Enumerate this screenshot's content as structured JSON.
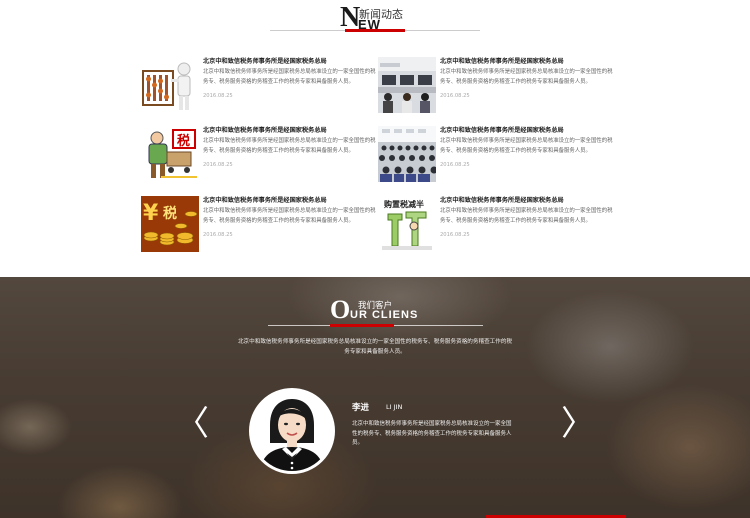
{
  "news": {
    "logo_letter": "N",
    "logo_rest": "EW",
    "title_cn": "新闻动态",
    "items": [
      {
        "title": "北京中和致信税务师事务所是经国家税务总局",
        "summary": "北京中和致信税务师事务所是经国家税务总局核准设立的一家全国性的税务专、税务服务资格的务稽查工作的税务专家和具备服务人员。",
        "date": "2016.08.25",
        "image": "abacus-figure-image"
      },
      {
        "title": "北京中和致信税务师事务所是经国家税务总局",
        "summary": "北京中和致信税务师事务所是经国家税务总局核准设立的一家全国性的税务专、税务服务资格的务稽查工作的税务专家和具备服务人员。",
        "date": "2016.08.25",
        "image": "office-workers-image"
      },
      {
        "title": "北京中和致信税务师事务所是经国家税务总局",
        "summary": "北京中和致信税务师事务所是经国家税务总局核准设立的一家全国性的税务专、税务服务资格的务稽查工作的税务专家和具备服务人员。",
        "date": "2016.08.25",
        "image": "tax-cart-cartoon-image"
      },
      {
        "title": "北京中和致信税务师事务所是经国家税务总局",
        "summary": "北京中和致信税务师事务所是经国家税务总局核准设立的一家全国性的税务专、税务服务资格的务稽查工作的税务专家和具备服务人员。",
        "date": "2016.08.25",
        "image": "conference-hall-image"
      },
      {
        "title": "北京中和致信税务师事务所是经国家税务总局",
        "summary": "北京中和致信税务师事务所是经国家税务总局核准设立的一家全国性的税务专、税务服务资格的务稽查工作的税务专家和具备服务人员。",
        "date": "2016.08.25",
        "image": "gold-coins-yen-image"
      },
      {
        "title": "北京中和致信税务师事务所是经国家税务总局",
        "summary": "北京中和致信税务师事务所是经国家税务总局核准设立的一家全国性的税务专、税务服务资格的务稽查工作的税务专家和具备服务人员。",
        "date": "2016.08.25",
        "image": "tax-reduction-cartoon-image",
        "image_caption": "购置税减半"
      }
    ]
  },
  "clients": {
    "logo_letter": "O",
    "logo_rest": "UR CLIENS",
    "title_cn": "我们客户",
    "description": "北京中和致信税务师事务所是经国家税务总局核准设立的一家全国性的税务专、税务服务资格的务稽查工作的税务专家和具备服务人员。",
    "prev_arrow": "〈",
    "next_arrow": "〉",
    "client": {
      "name": "李进",
      "name_en": "LI JIN",
      "quote": "北京中和致信税务师事务所是经国家税务总局核准设立的一家全国性的税务专、税务服务资格的务稽查工作的税务专家和具备服务人员。"
    }
  },
  "colors": {
    "accent": "#cc0000",
    "text_dark": "#222222",
    "text_muted": "#666666"
  }
}
